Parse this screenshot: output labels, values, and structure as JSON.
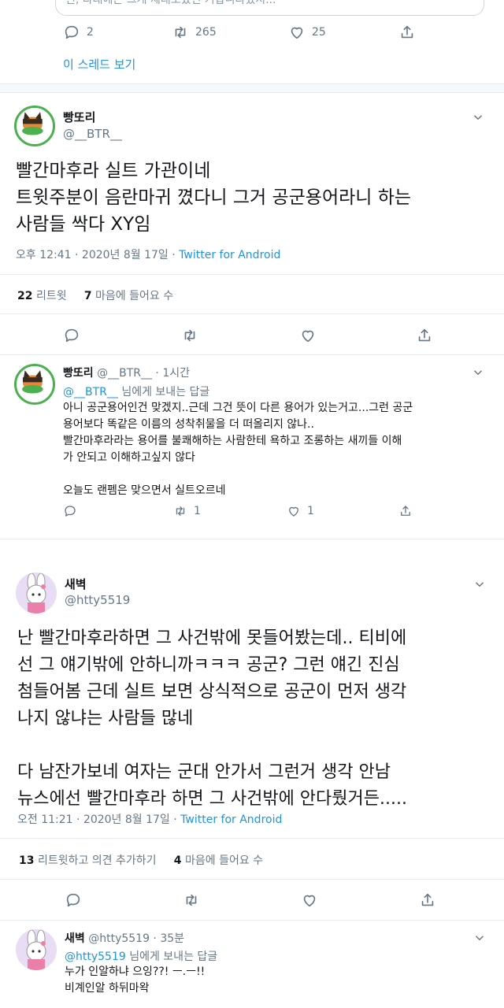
{
  "top": {
    "partial_text": "린, 다래에는 그게 제대로였던 거랍니다겠지...",
    "reply_count": "2",
    "retweet_count": "265",
    "like_count": "25",
    "show_thread": "이 스레드 보기"
  },
  "tweet1": {
    "name": "빵또리",
    "handle": "@__BTR__",
    "text": "빨간마후라 실트 가관이네\n트윗주분이 음란마귀 꼈다니 그거 공군용어라니 하는\n사람들 싹다 XY임",
    "time": "오후 12:41 · 2020년 8월 17일 · ",
    "source": "Twitter for Android",
    "retweets_num": "22",
    "retweets_label": "리트윗",
    "likes_num": "7",
    "likes_label": "마음에 들어요 수"
  },
  "reply1": {
    "name": "빵또리",
    "handle_time": "@__BTR__ · 1시간",
    "to_handle": "@__BTR__",
    "to_suffix": " 님에게 보내는 답글",
    "text": "아니 공군용어인건 맞겠지..근데 그건 뜻이 다른 용어가 있는거고...그런 공군\n용어보다 똑같은 이름의 성착취물을 더 떠올리지 않나..\n빨간마후라라는 용어를 불쾌해하는 사람한테 욕하고 조롱하는 새끼들 이해\n가 안되고 이해하고싶지 않다\n\n오늘도 랜펨은 맞으면서 실트오르네",
    "retweet_count": "1",
    "like_count": "1"
  },
  "tweet2": {
    "name": "새벽",
    "handle": "@htty5519",
    "text": "난 빨간마후라하면 그 사건밖에 못들어봤는데.. 티비에\n선 그 얘기밖에 안하니까ㅋㅋㅋ 공군? 그런 얘긴 진심\n첨들어봄 근데 실트 보면 상식적으로 공군이 먼저 생각\n나지 않냐는 사람들 많네\n\n다 남잔가보네 여자는 군대 안가서 그런거 생각 안남\n뉴스에선 빨간마후라 하면 그 사건밖에 안다뤘거든.....",
    "time": "오전 11:21 · 2020년 8월 17일 · ",
    "source": "Twitter for Android",
    "retweets_num": "13",
    "retweets_label": "리트윗하고 의견 추가하기",
    "likes_num": "4",
    "likes_label": "마음에 들어요 수"
  },
  "reply2": {
    "name": "새벽",
    "handle_time": "@htty5519 · 35분",
    "to_handle": "@htty5519",
    "to_suffix": " 님에게 보내는 답글",
    "text": "누가 인알하냐 으잉??! ㅡ.ㅡ!!\n비계인알 하뒤마왁"
  },
  "colors": {
    "link": "#1b95e0",
    "muted": "#657786",
    "text": "#14171a",
    "border": "#e6ecf0"
  },
  "icons": [
    "reply-icon",
    "retweet-icon",
    "like-icon",
    "share-icon",
    "chevron-down-icon"
  ]
}
